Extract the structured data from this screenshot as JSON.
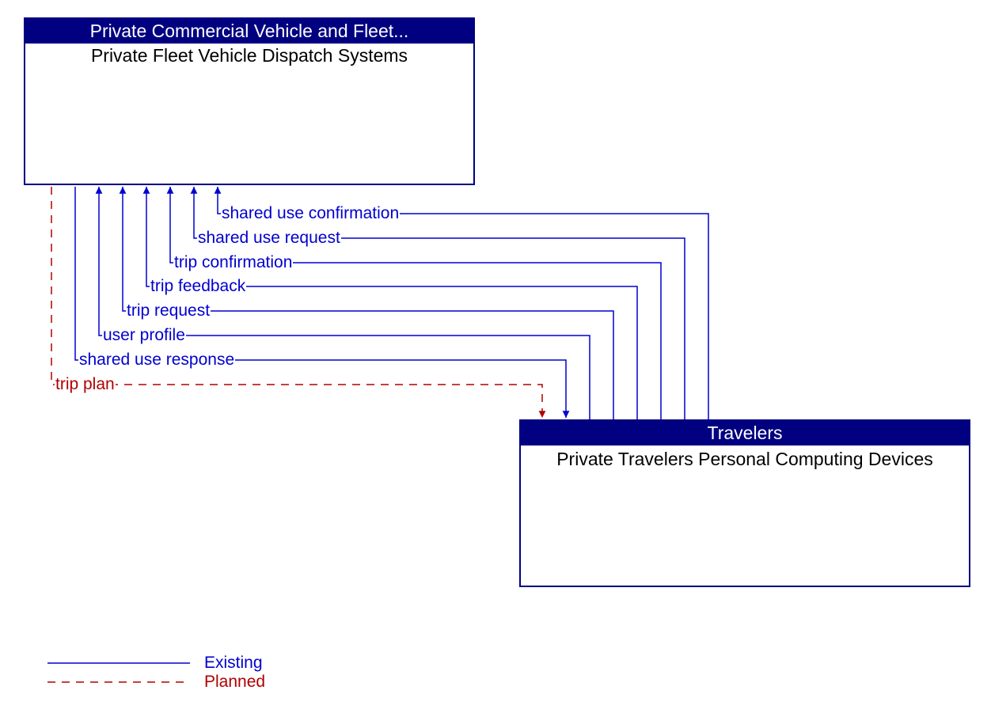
{
  "boxA": {
    "header": "Private Commercial Vehicle and Fleet...",
    "body": "Private Fleet Vehicle Dispatch Systems"
  },
  "boxB": {
    "header": "Travelers",
    "body": "Private Travelers Personal Computing Devices"
  },
  "flows": {
    "f1": "shared use confirmation",
    "f2": "shared use request",
    "f3": "trip confirmation",
    "f4": "trip feedback",
    "f5": "trip request",
    "f6": "user profile",
    "f7": "shared use response",
    "f8": "trip plan"
  },
  "legend": {
    "existing": "Existing",
    "planned": "Planned"
  },
  "chart_data": {
    "type": "diagram",
    "title": "",
    "nodes": [
      {
        "id": "A",
        "group": "Private Commercial Vehicle and Fleet...",
        "name": "Private Fleet Vehicle Dispatch Systems"
      },
      {
        "id": "B",
        "group": "Travelers",
        "name": "Private Travelers Personal Computing Devices"
      }
    ],
    "flows": [
      {
        "from": "B",
        "to": "A",
        "label": "shared use confirmation",
        "status": "existing"
      },
      {
        "from": "B",
        "to": "A",
        "label": "shared use request",
        "status": "existing"
      },
      {
        "from": "B",
        "to": "A",
        "label": "trip confirmation",
        "status": "existing"
      },
      {
        "from": "B",
        "to": "A",
        "label": "trip feedback",
        "status": "existing"
      },
      {
        "from": "B",
        "to": "A",
        "label": "trip request",
        "status": "existing"
      },
      {
        "from": "B",
        "to": "A",
        "label": "user profile",
        "status": "existing"
      },
      {
        "from": "A",
        "to": "B",
        "label": "shared use response",
        "status": "existing"
      },
      {
        "from": "A",
        "to": "B",
        "label": "trip plan",
        "status": "planned"
      }
    ],
    "legend": [
      {
        "status": "existing",
        "label": "Existing",
        "style": "solid",
        "color": "#0000d0"
      },
      {
        "status": "planned",
        "label": "Planned",
        "style": "dashed",
        "color": "#b00000"
      }
    ]
  }
}
